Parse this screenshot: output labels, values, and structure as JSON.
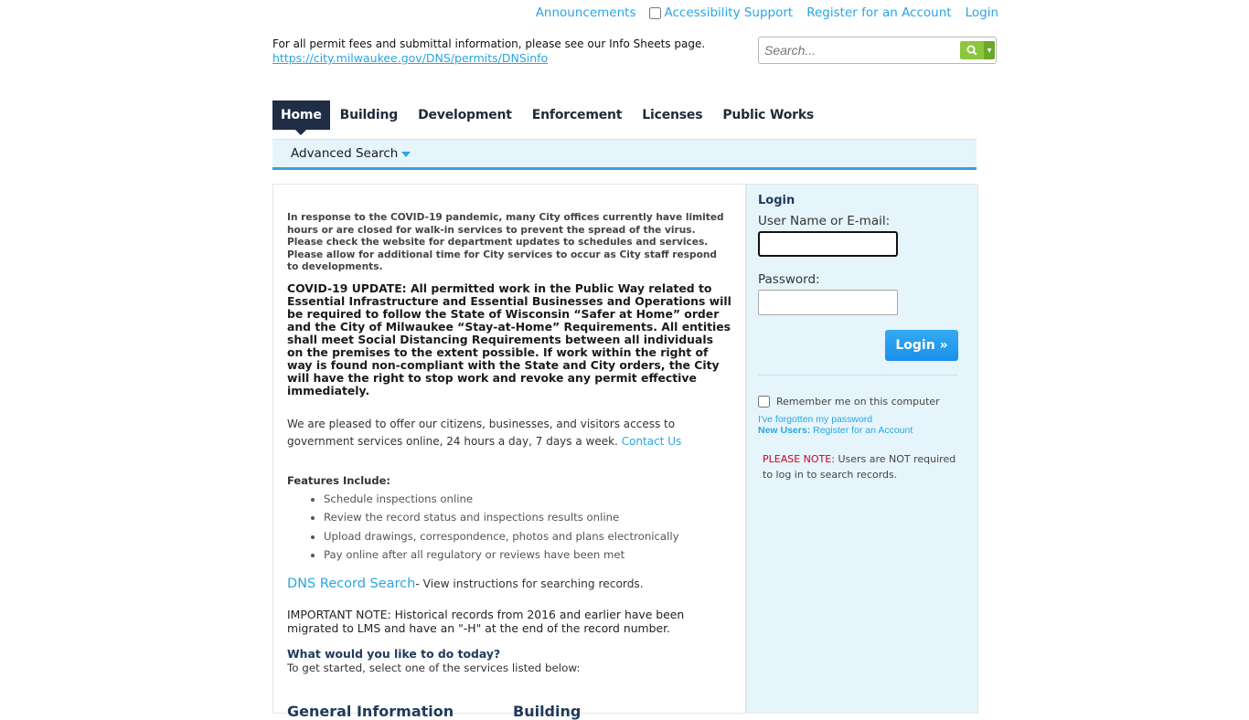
{
  "top_links": {
    "announcements": "Announcements",
    "accessibility_support": "Accessibility Support",
    "register": "Register for an Account",
    "login": "Login"
  },
  "info_line": {
    "text": "For all permit fees and submittal information, please see our Info Sheets page.",
    "link": "https://city.milwaukee.gov/DNS/permits/DNSinfo"
  },
  "search": {
    "placeholder": "Search...",
    "button_icon": "search-icon",
    "dropdown_icon": "caret-down-icon"
  },
  "nav": {
    "tabs": [
      {
        "label": "Home",
        "active": true
      },
      {
        "label": "Building",
        "active": false
      },
      {
        "label": "Development",
        "active": false
      },
      {
        "label": "Enforcement",
        "active": false
      },
      {
        "label": "Licenses",
        "active": false
      },
      {
        "label": "Public Works",
        "active": false
      }
    ],
    "sub": {
      "advanced_search": "Advanced Search"
    }
  },
  "main": {
    "covid_notice": "In response to the COVID-19 pandemic, many City offices currently have limited hours or are closed for walk-in services to prevent the spread of the virus. Please check the website for department updates to schedules and services. Please allow for additional time for City services to occur as City staff respond to developments.",
    "covid_update": "COVID-19 UPDATE: All permitted work in the Public Way related to Essential Infrastructure and Essential Businesses and Operations will be required to follow the State of Wisconsin “Safer at Home” order and the City of Milwaukee “Stay-at-Home” Requirements. All entities shall meet Social Distancing Requirements between all individuals on the premises to the extent possible. If work within the right of way is found non-compliant with the State and City orders, the City will have the right to stop work and revoke any permit effective immediately.",
    "welcome_text": "We are pleased to offer our citizens, businesses, and visitors access to government services online, 24 hours a day, 7 days a week.",
    "contact_us": "Contact Us",
    "features_heading": "Features Include:",
    "features": [
      "Schedule inspections online",
      "Review the record status and inspections results online",
      "Upload drawings, correspondence, photos and plans electronically",
      "Pay online after all regulatory or reviews have been met"
    ],
    "dns_link": "DNS Record Search",
    "dns_text": "- View instructions for searching records.",
    "important_note": "IMPORTANT NOTE: Historical records from 2016 and earlier have been migrated to LMS and have an \"-H\" at the end of the record number.",
    "todo_heading": "What would you like to do today?",
    "todo_sub": "To get started, select one of the services listed below:",
    "services": [
      "General Information",
      "Building"
    ]
  },
  "login": {
    "title": "Login",
    "username_label": "User Name or E-mail:",
    "username_value": "",
    "password_label": "Password:",
    "password_value": "",
    "button": "Login »",
    "remember": "Remember me on this computer",
    "forgot": "I've forgotten my password",
    "new_users_label": "New Users:",
    "new_users_link": "Register for an Account",
    "note_label": "PLEASE NOTE:",
    "note_text": "Users are NOT required to log in to search records."
  }
}
